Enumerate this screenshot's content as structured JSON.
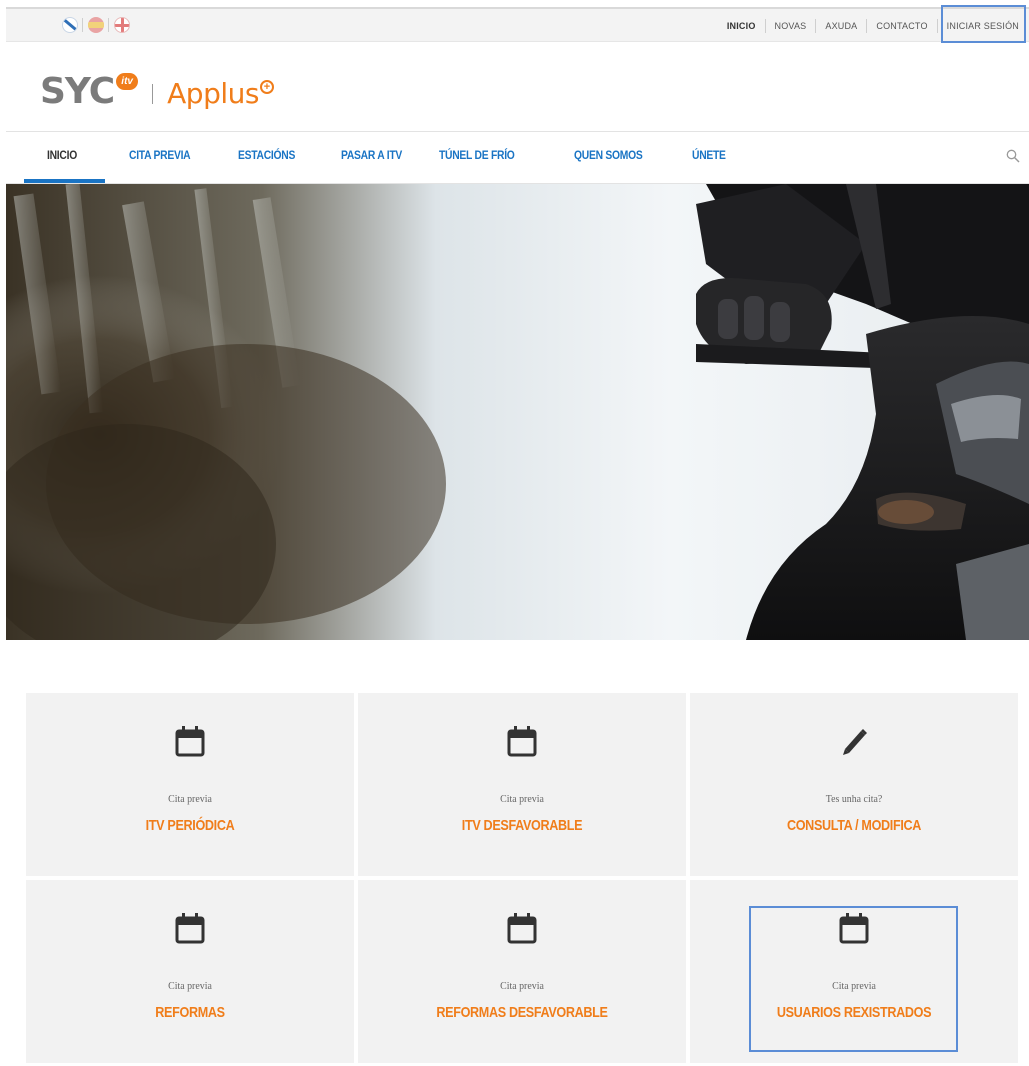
{
  "languages": [
    "gl",
    "es",
    "en"
  ],
  "utility_nav": [
    "INICIO",
    "NOVAS",
    "AXUDA",
    "CONTACTO",
    "INICIAR SESIÓN"
  ],
  "logo": {
    "brand": "SYC",
    "badge": "itv",
    "partner": "Applus"
  },
  "main_nav": [
    "INICIO",
    "CITA PREVIA",
    "ESTACIÓNS",
    "PASAR A ITV",
    "TÚNEL DE FRÍO",
    "QUEN SOMOS",
    "ÚNETE"
  ],
  "tiles": [
    {
      "sub": "Cita previa",
      "title": "ITV PERIÓDICA",
      "icon": "calendar-icon"
    },
    {
      "sub": "Cita previa",
      "title": "ITV DESFAVORABLE",
      "icon": "calendar-icon"
    },
    {
      "sub": "Tes unha cita?",
      "title": "CONSULTA / MODIFICA",
      "icon": "pencil-icon"
    },
    {
      "sub": "Cita previa",
      "title": "REFORMAS",
      "icon": "calendar-icon"
    },
    {
      "sub": "Cita previa",
      "title": "REFORMAS DESFAVORABLE",
      "icon": "calendar-icon"
    },
    {
      "sub": "Cita previa",
      "title": "USUARIOS REXISTRADOS",
      "icon": "calendar-icon"
    }
  ],
  "colors": {
    "accent": "#f07d1a",
    "nav_blue": "#1a74c4",
    "tile_bg": "#f2f2f2",
    "highlight": "#5b8dd6"
  }
}
